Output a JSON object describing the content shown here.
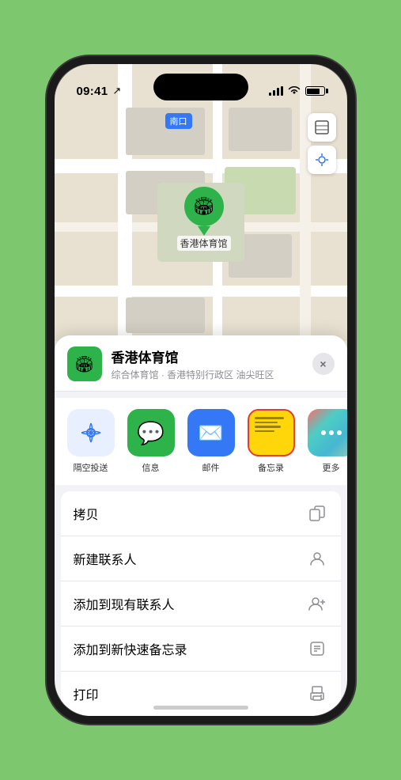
{
  "status_bar": {
    "time": "09:41",
    "location_arrow": "▲"
  },
  "map": {
    "label": "南口",
    "stadium_name": "香港体育馆"
  },
  "sheet": {
    "title": "香港体育馆",
    "subtitle": "综合体育馆 · 香港特别行政区 油尖旺区",
    "close_label": "×"
  },
  "share_items": [
    {
      "id": "airdrop",
      "label": "隔空投送",
      "emoji": "📡"
    },
    {
      "id": "message",
      "label": "信息",
      "emoji": "💬"
    },
    {
      "id": "mail",
      "label": "邮件",
      "emoji": "✉️"
    },
    {
      "id": "notes",
      "label": "备忘录",
      "emoji": "notes"
    },
    {
      "id": "more",
      "label": "更多",
      "emoji": "⋯"
    }
  ],
  "actions": [
    {
      "id": "copy",
      "label": "拷贝",
      "icon": "copy"
    },
    {
      "id": "new-contact",
      "label": "新建联系人",
      "icon": "person"
    },
    {
      "id": "add-existing",
      "label": "添加到现有联系人",
      "icon": "person-add"
    },
    {
      "id": "add-notes",
      "label": "添加到新快速备忘录",
      "icon": "note"
    },
    {
      "id": "print",
      "label": "打印",
      "icon": "print"
    }
  ]
}
